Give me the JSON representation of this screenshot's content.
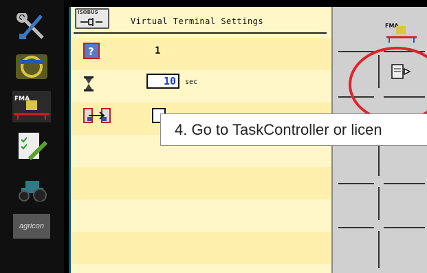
{
  "header": {
    "title": "Virtual Terminal Settings",
    "logo_text": "ISOBUS"
  },
  "settings": {
    "row1_value": "1",
    "timeout_value": "10",
    "timeout_unit": "sec"
  },
  "sidebar": {
    "brand_text": "agricon",
    "fma_text": "FMA"
  },
  "softkeys": {
    "fma_text": "FMA"
  },
  "tooltip": {
    "text": "4. Go to TaskController or licen"
  },
  "colors": {
    "highlight_ring": "#e1232d",
    "panel_bg": "#fff7c8",
    "input_value": "#1a3ec8"
  }
}
